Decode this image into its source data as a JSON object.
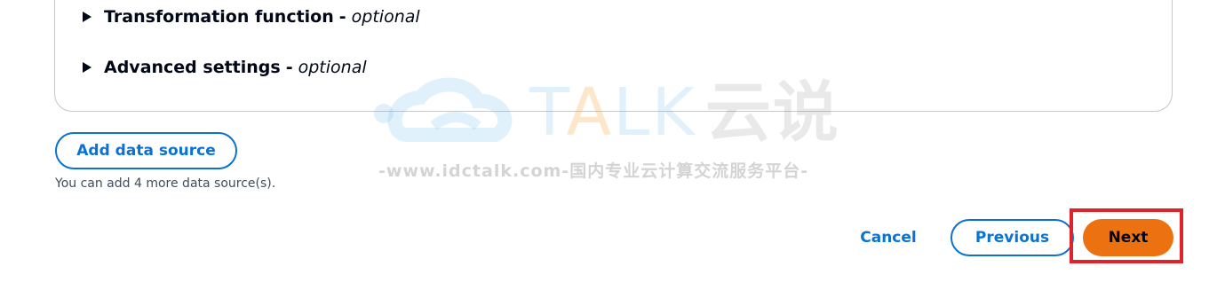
{
  "panel": {
    "expanders": [
      {
        "title": "Transformation function",
        "separator": "-",
        "optional": "optional"
      },
      {
        "title": "Advanced settings",
        "separator": "-",
        "optional": "optional"
      }
    ]
  },
  "data_sources": {
    "add_button_label": "Add data source",
    "hint": "You can add 4 more data source(s)."
  },
  "footer": {
    "cancel_label": "Cancel",
    "previous_label": "Previous",
    "next_label": "Next"
  },
  "watermark": {
    "brand_prefix": "T",
    "brand_a": "A",
    "brand_suffix": "LK",
    "brand_cn": "云说",
    "url": "-www.idctalk.com-国内专业云计算交流服务平台-"
  },
  "colors": {
    "primary": "#ec7211",
    "link": "#0972d3",
    "highlight": "#e0232b",
    "text": "#000716"
  }
}
